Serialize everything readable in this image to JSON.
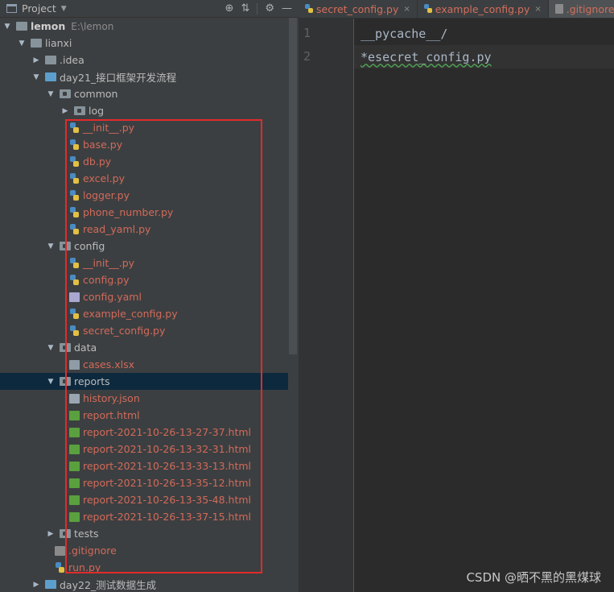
{
  "panel": {
    "title": "Project",
    "tools": [
      "⊕",
      "⇅",
      "⚙",
      "—"
    ]
  },
  "tree": [
    {
      "level": 0,
      "expanded": true,
      "kind": "folder",
      "label": "lemon",
      "bold": true,
      "path": "E:\\lemon"
    },
    {
      "level": 1,
      "expanded": true,
      "kind": "folder",
      "label": "lianxi"
    },
    {
      "level": 2,
      "expanded": false,
      "kind": "folder",
      "label": ".idea"
    },
    {
      "level": 2,
      "expanded": true,
      "kind": "folder-blue",
      "label": "day21_接口框架开发流程"
    },
    {
      "level": 3,
      "expanded": true,
      "kind": "package",
      "label": "common"
    },
    {
      "level": 4,
      "expanded": false,
      "kind": "package",
      "label": "log"
    },
    {
      "level": 4,
      "kind": "py",
      "label": "__init__.py",
      "red": true
    },
    {
      "level": 4,
      "kind": "py",
      "label": "base.py",
      "red": true
    },
    {
      "level": 4,
      "kind": "py",
      "label": "db.py",
      "red": true
    },
    {
      "level": 4,
      "kind": "py",
      "label": "excel.py",
      "red": true
    },
    {
      "level": 4,
      "kind": "py",
      "label": "logger.py",
      "red": true
    },
    {
      "level": 4,
      "kind": "py",
      "label": "phone_number.py",
      "red": true
    },
    {
      "level": 4,
      "kind": "py",
      "label": "read_yaml.py",
      "red": true
    },
    {
      "level": 3,
      "expanded": true,
      "kind": "package",
      "label": "config"
    },
    {
      "level": 4,
      "kind": "py",
      "label": "__init__.py",
      "red": true
    },
    {
      "level": 4,
      "kind": "py",
      "label": "config.py",
      "red": true
    },
    {
      "level": 4,
      "kind": "yml",
      "label": "config.yaml",
      "red": true
    },
    {
      "level": 4,
      "kind": "py",
      "label": "example_config.py",
      "red": true
    },
    {
      "level": 4,
      "kind": "py",
      "label": "secret_config.py",
      "red": true
    },
    {
      "level": 3,
      "expanded": true,
      "kind": "package",
      "label": "data"
    },
    {
      "level": 4,
      "kind": "xlsx",
      "label": "cases.xlsx",
      "red": true
    },
    {
      "level": 3,
      "expanded": true,
      "kind": "package",
      "label": "reports",
      "selected": true
    },
    {
      "level": 4,
      "kind": "json",
      "label": "history.json",
      "red": true
    },
    {
      "level": 4,
      "kind": "html",
      "label": "report.html",
      "red": true
    },
    {
      "level": 4,
      "kind": "html",
      "label": "report-2021-10-26-13-27-37.html",
      "red": true
    },
    {
      "level": 4,
      "kind": "html",
      "label": "report-2021-10-26-13-32-31.html",
      "red": true
    },
    {
      "level": 4,
      "kind": "html",
      "label": "report-2021-10-26-13-33-13.html",
      "red": true
    },
    {
      "level": 4,
      "kind": "html",
      "label": "report-2021-10-26-13-35-12.html",
      "red": true
    },
    {
      "level": 4,
      "kind": "html",
      "label": "report-2021-10-26-13-35-48.html",
      "red": true
    },
    {
      "level": 4,
      "kind": "html",
      "label": "report-2021-10-26-13-37-15.html",
      "red": true
    },
    {
      "level": 3,
      "expanded": false,
      "kind": "package",
      "label": "tests"
    },
    {
      "level": 3,
      "kind": "git",
      "label": ".gitignore",
      "red": true
    },
    {
      "level": 3,
      "kind": "py",
      "label": "run.py",
      "red": true
    },
    {
      "level": 2,
      "expanded": false,
      "kind": "folder-blue",
      "label": "day22_测试数据生成"
    }
  ],
  "tabs": [
    {
      "label": "secret_config.py",
      "icon": "py"
    },
    {
      "label": "example_config.py",
      "icon": "py"
    },
    {
      "label": ".gitignore",
      "icon": "git",
      "active": true
    }
  ],
  "editor": {
    "lines": [
      {
        "no": "1",
        "text": "__pycache__/"
      },
      {
        "no": "2",
        "text": "*esecret_config.py"
      }
    ]
  },
  "watermark": "CSDN @晒不黑的黑煤球",
  "colors": {
    "highlight": "#e12b2b",
    "untracked": "#d26a5a",
    "selected_row": "#0d293e"
  }
}
